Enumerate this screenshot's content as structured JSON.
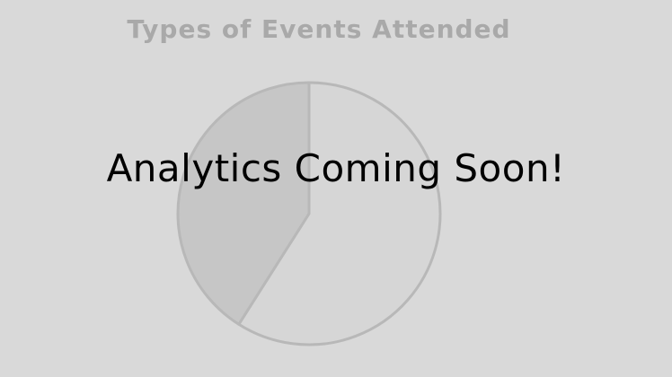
{
  "panel": {
    "overlay_message": "Analytics Coming Soon!"
  },
  "colors": {
    "background": "#d9d9d9",
    "title": "#a9a9a9",
    "slice_large": "#d6d6d6",
    "slice_small": "#c6c6c6",
    "slice_stroke": "#b8b8b8",
    "overlay_text": "#000000"
  },
  "chart_data": {
    "type": "pie",
    "title": "Types of Events Attended",
    "slices": [
      {
        "value": 59
      },
      {
        "value": 41
      }
    ]
  }
}
